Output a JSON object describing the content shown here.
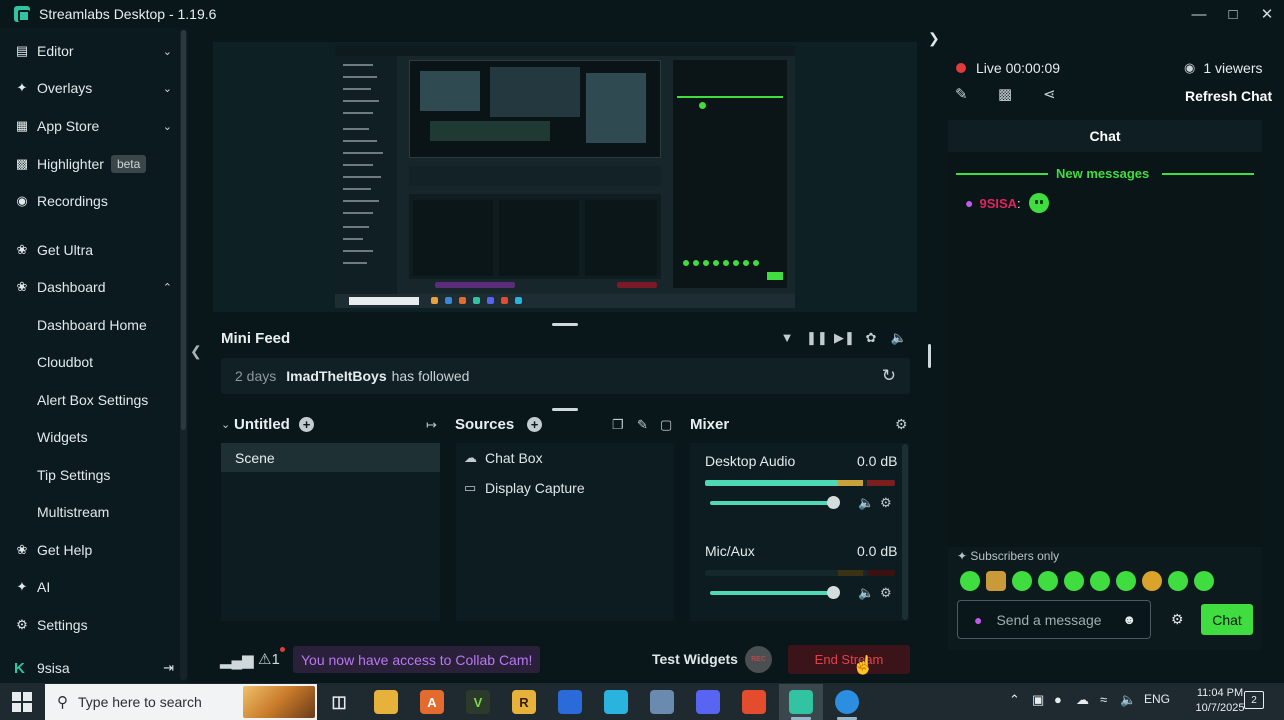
{
  "window": {
    "title": "Streamlabs Desktop - 1.19.6"
  },
  "sidebar": {
    "items": [
      {
        "label": "Editor"
      },
      {
        "label": "Overlays"
      },
      {
        "label": "App Store"
      },
      {
        "label": "Highlighter",
        "badge": "beta"
      },
      {
        "label": "Recordings"
      },
      {
        "label": "Get Ultra"
      },
      {
        "label": "Dashboard"
      },
      {
        "label": "Dashboard Home"
      },
      {
        "label": "Cloudbot"
      },
      {
        "label": "Alert Box Settings"
      },
      {
        "label": "Widgets"
      },
      {
        "label": "Tip Settings"
      },
      {
        "label": "Multistream"
      },
      {
        "label": "Get Help"
      },
      {
        "label": "AI"
      },
      {
        "label": "Settings"
      }
    ],
    "user": {
      "initial": "K",
      "name": "9sisa"
    }
  },
  "minifeed": {
    "title": "Mini Feed",
    "event": {
      "ago": "2 days",
      "user": "ImadTheItBoys",
      "action": "has followed"
    }
  },
  "scenes": {
    "title": "Untitled",
    "items": [
      "Scene"
    ]
  },
  "sources": {
    "title": "Sources",
    "items": [
      "Chat Box",
      "Display Capture"
    ]
  },
  "mixer": {
    "title": "Mixer",
    "channels": [
      {
        "name": "Desktop Audio",
        "db": "0.0 dB",
        "level": 0.7,
        "volume": 0.99
      },
      {
        "name": "Mic/Aux",
        "db": "0.0 dB",
        "level": 0.0,
        "volume": 0.99
      }
    ]
  },
  "footer": {
    "alerts": "1",
    "collab_notice": "You now have access to Collab Cam!",
    "test_widgets": "Test Widgets",
    "rec_label": "REC",
    "end_stream": "End Stream"
  },
  "live": {
    "status": "Live 00:00:09",
    "viewers": "1 viewers",
    "refresh_chat": "Refresh Chat"
  },
  "chat": {
    "title": "Chat",
    "new_messages": "New messages",
    "message": {
      "user": "9SISA",
      "sep": ":"
    },
    "subscribers_only": "Subscribers only",
    "input_placeholder": "Send a message",
    "send": "Chat"
  },
  "taskbar": {
    "search_placeholder": "Type here to search",
    "lang": "ENG",
    "time": "11:04 PM",
    "date": "10/7/2025",
    "notifications": "2"
  },
  "colors": {
    "accent": "#31c3a2",
    "chat_green": "#3fdd3f",
    "live_red": "#e23b3b",
    "collab_purple": "#b878f2",
    "end_red": "#e5404a"
  }
}
